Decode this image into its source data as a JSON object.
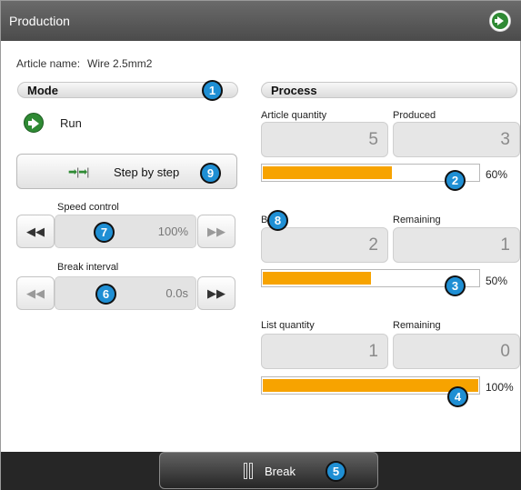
{
  "window": {
    "title": "Production",
    "nav_icon": "forward-circle-icon"
  },
  "article": {
    "label": "Article name:",
    "value": "Wire 2.5mm2"
  },
  "mode": {
    "heading": "Mode",
    "run_label": "Run",
    "run_icon": "run-arrow-icon",
    "step_button": {
      "label": "Step by step",
      "icon": "step-arrows-icon"
    },
    "speed_control": {
      "label": "Speed control",
      "value": "100%",
      "left_icon": "rewind-icon",
      "right_icon": "fast-forward-icon"
    },
    "break_interval": {
      "label": "Break interval",
      "value": "0.0s",
      "left_icon": "rewind-icon",
      "right_icon": "fast-forward-icon"
    }
  },
  "process": {
    "heading": "Process",
    "article_quantity": {
      "label": "Article quantity",
      "value": "5"
    },
    "produced": {
      "label": "Produced",
      "value": "3"
    },
    "progress1": {
      "percent": 60,
      "text": "60%"
    },
    "batch_size": {
      "label": "B size",
      "value": "2"
    },
    "remaining1": {
      "label": "Remaining",
      "value": "1"
    },
    "progress2": {
      "percent": 50,
      "text": "50%"
    },
    "list_quantity": {
      "label": "List quantity",
      "value": "1"
    },
    "remaining2": {
      "label": "Remaining",
      "value": "0"
    },
    "progress3": {
      "percent": 100,
      "text": "100%"
    }
  },
  "footer": {
    "break_label": "Break",
    "break_icon": "pause-icon"
  },
  "markers": [
    "1",
    "2",
    "3",
    "4",
    "5",
    "6",
    "7",
    "8",
    "9"
  ],
  "colors": {
    "progress_fill": "#f7a300",
    "marker": "#1f8fd4",
    "run_green": "#2f8a34"
  }
}
